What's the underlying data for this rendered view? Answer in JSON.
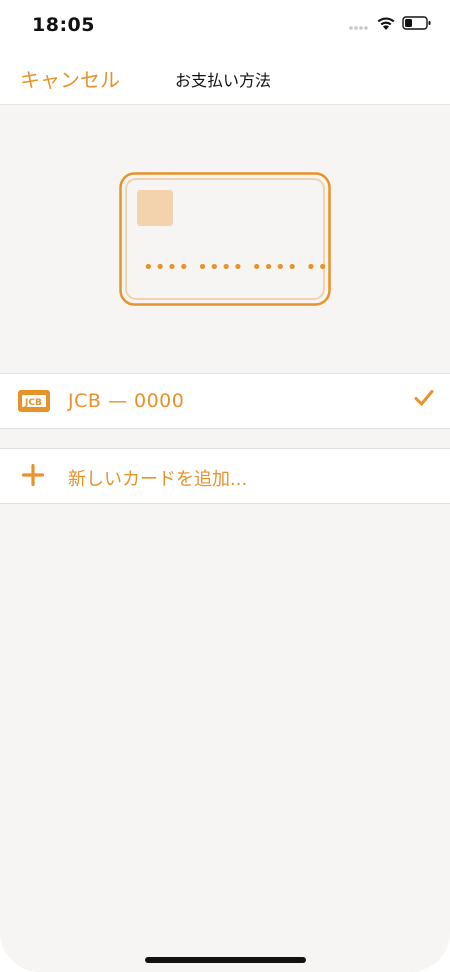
{
  "status_bar": {
    "time": "18:05",
    "signal_icon": "signal-dots-icon",
    "wifi_icon": "wifi-icon",
    "battery_icon": "battery-icon"
  },
  "nav": {
    "cancel_label": "キャンセル",
    "title": "お支払い方法"
  },
  "card_preview": {
    "masked_number": "•••• •••• •••• ••••"
  },
  "payment_methods": [
    {
      "logo_text": "JCB",
      "label": "JCB — 0000",
      "selected": true,
      "logo_icon": "jcb-logo-icon",
      "check_icon": "checkmark-icon"
    }
  ],
  "add_card": {
    "label": "新しいカードを追加...",
    "icon": "plus-icon"
  },
  "colors": {
    "accent": "#e8922a",
    "background": "#f6f5f3",
    "card_chip": "#f2d3ae",
    "card_border_outer": "#e8922a",
    "card_border_inner": "#f2d3ae"
  }
}
